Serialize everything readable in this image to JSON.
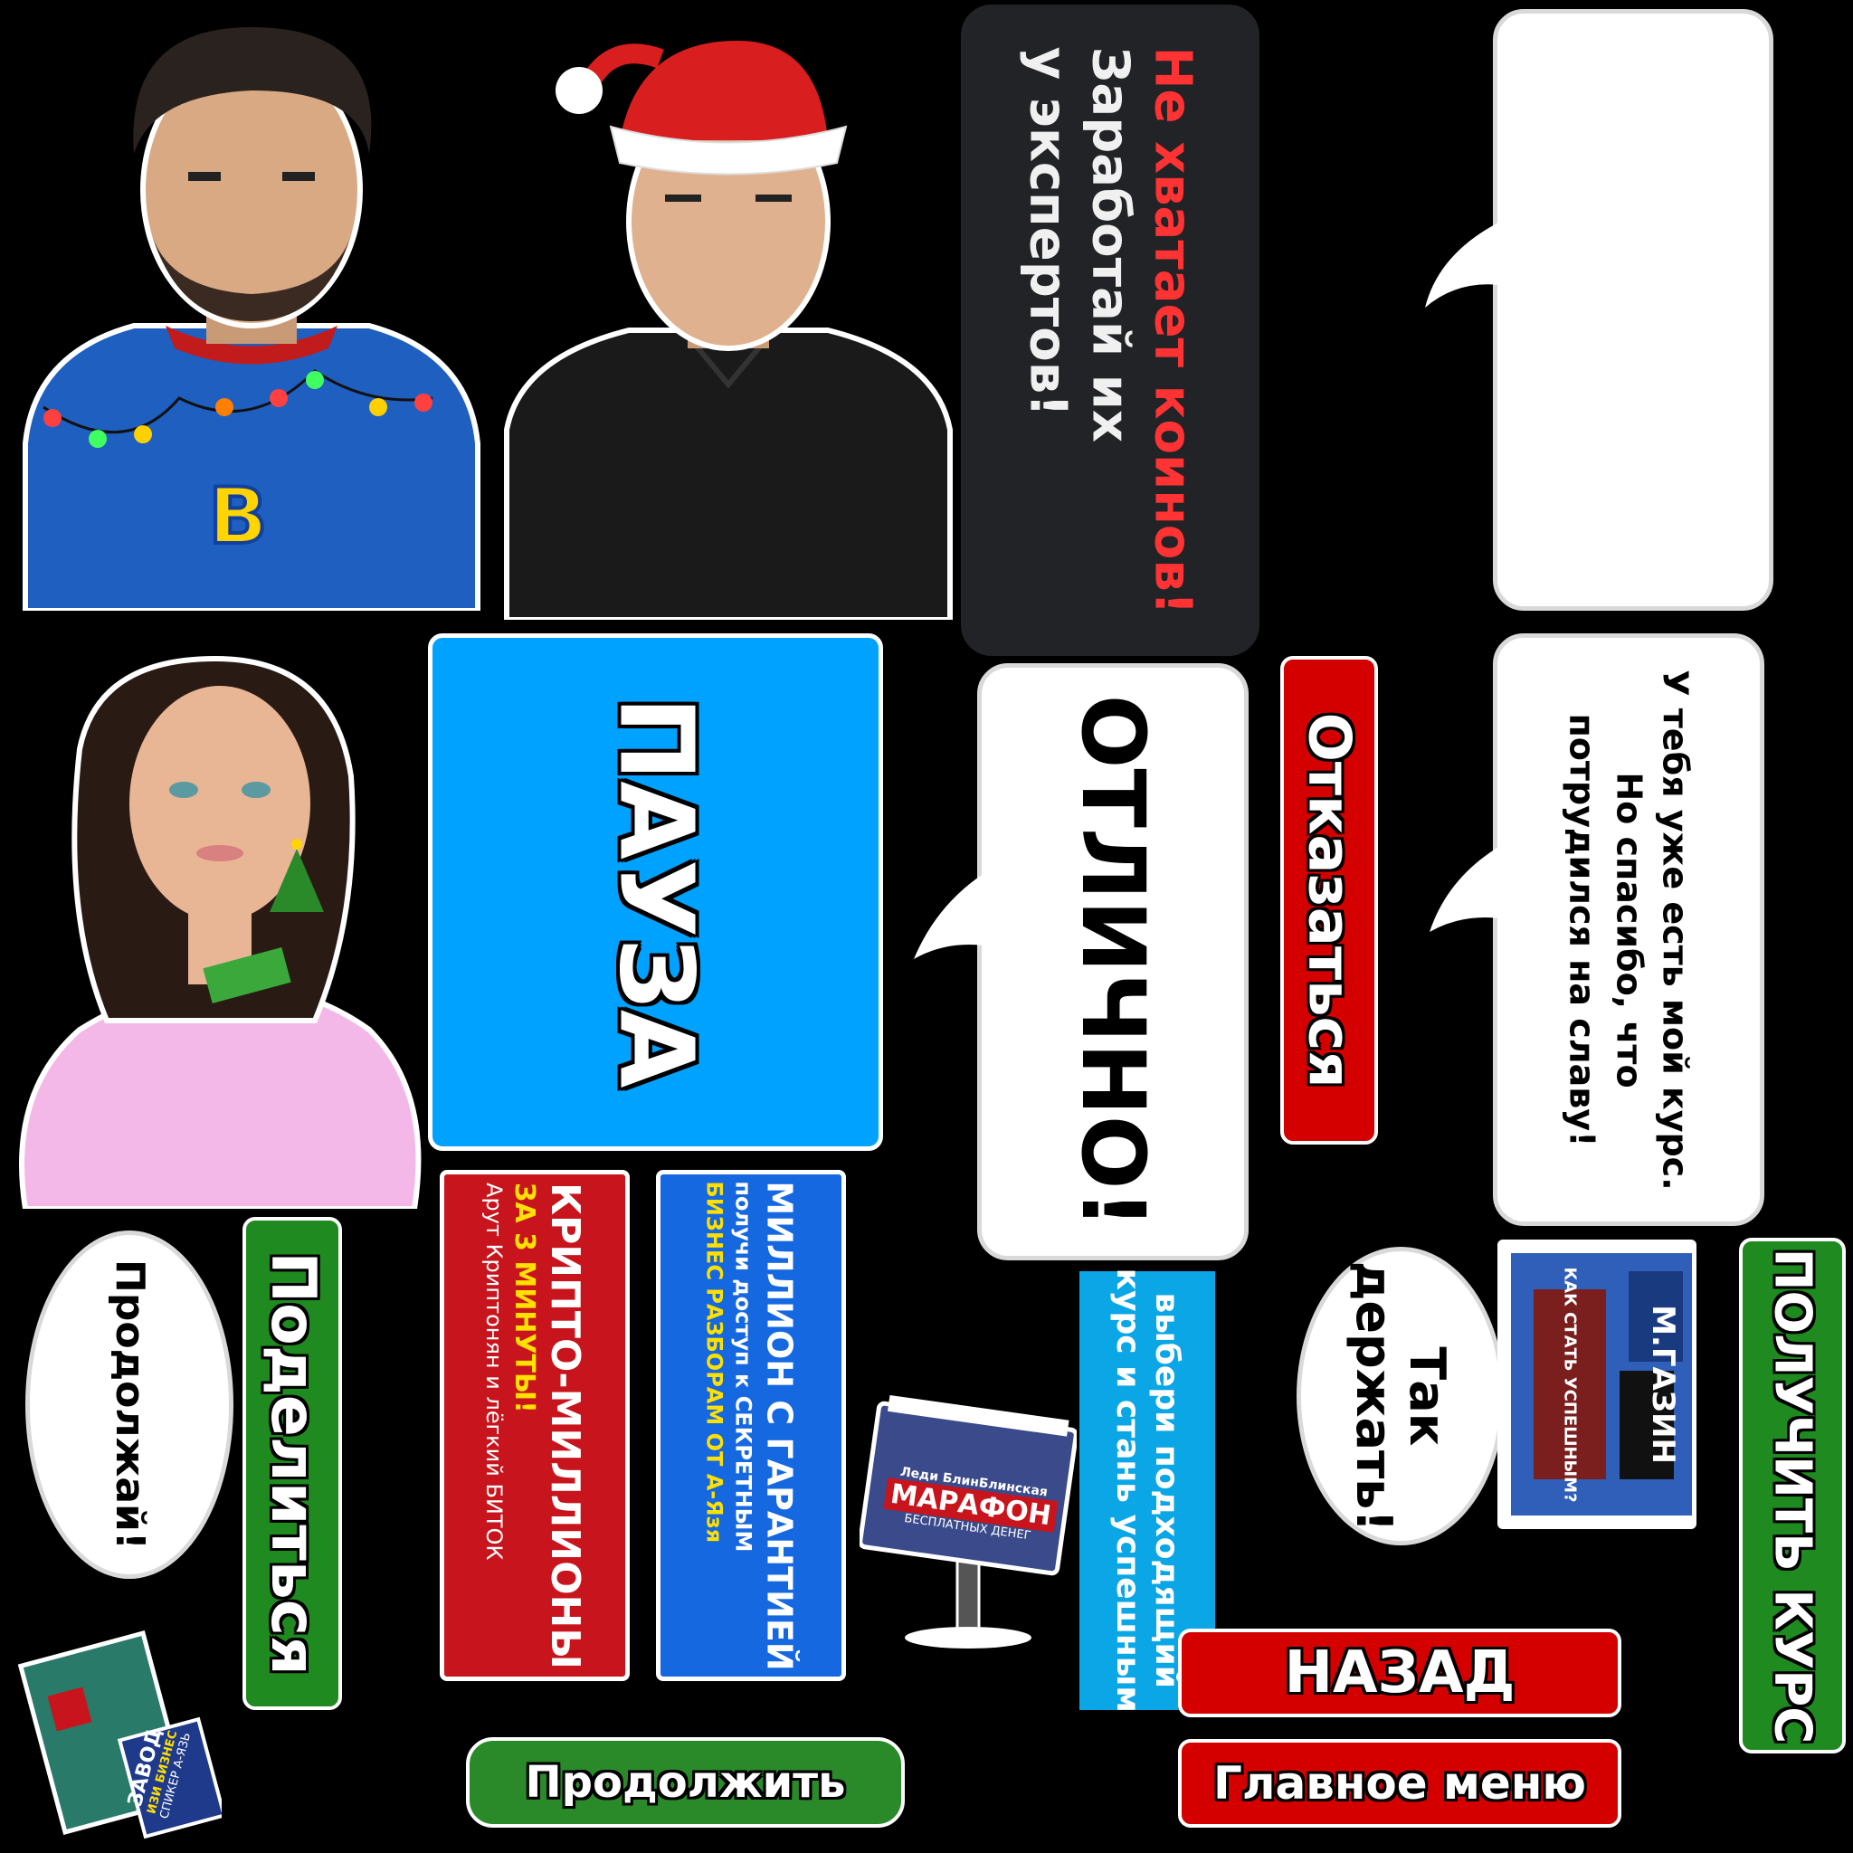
{
  "dialog": {
    "dark_line1": "Не хватает коинов!",
    "dark_line2": "Заработай их",
    "dark_line3": "у экспертов!",
    "course_reply": "У тебя уже есть мой курс.\nНо спасибо, что\nпотрудился на славу!",
    "excellent": "ОТЛИЧНО!",
    "keep_going": "Так\nдержать!",
    "continue_bubble": "Продолжай!"
  },
  "buttons": {
    "pause": "ПАУЗА",
    "refuse": "Отказаться",
    "share": "Поделиться",
    "get_course": "ПОЛУЧИТЬ КУРС",
    "back": "НАЗАД",
    "main_menu": "Главное меню",
    "continue": "Продолжить"
  },
  "banners": {
    "crypto_title": "КРИПТО-МИЛЛИОНЫ",
    "crypto_sub": "ЗА 3 МИНУТЫ!",
    "crypto_small": "Арут Криптонян и лёгкий БИТОК",
    "million_title": "МИЛЛИОН С ГАРАНТИЕЙ",
    "million_l1": "получи доступ к СЕКРЕТНЫМ",
    "million_l2": "БИЗНЕС РАЗБОРАМ ОТ А-Язя",
    "choose_course": "выбери подходящий\nкурс и стань успешным"
  },
  "signs": {
    "marathon_top": "Леди БлинБлинская",
    "marathon_title": "МАРАФОН",
    "marathon_sub": "БЕСПЛАТНЫХ ДЕНЕГ",
    "shop_title": "М.ГАЗИН",
    "shop_sub": "КАК СТАТЬ УСПЕШНЫМ?",
    "factory_title": "ЗАВОД",
    "factory_sub1": "ИЗИ БИЗНЕС",
    "factory_sub2": "СПИКЕР А-ЯЗЬ"
  },
  "icons": {
    "sweater_logo": "B"
  },
  "colors": {
    "pause_blue": "#00a2ff",
    "red": "#d40000",
    "green": "#1f8a1f",
    "cyan_label": "#0aa6e6"
  }
}
